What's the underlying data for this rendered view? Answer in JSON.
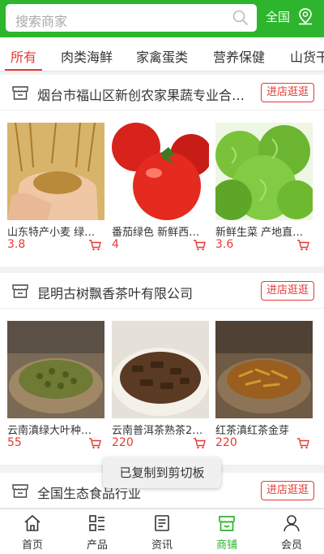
{
  "header": {
    "search_placeholder": "搜索商家",
    "region": "全国"
  },
  "tabs": [
    {
      "label": "所有",
      "active": true
    },
    {
      "label": "肉类海鲜"
    },
    {
      "label": "家禽蛋类"
    },
    {
      "label": "营养保健"
    },
    {
      "label": "山货干"
    }
  ],
  "shops": [
    {
      "name": "烟台市福山区新创农家果蔬专业合…",
      "visit_label": "进店逛逛",
      "products": [
        {
          "name": "山东特产小麦 绿…",
          "price": "3.8"
        },
        {
          "name": "番茄绿色 新鲜西…",
          "price": "4"
        },
        {
          "name": "新鲜生菜 产地直…",
          "price": "3.6"
        }
      ]
    },
    {
      "name": "昆明古树飘香茶叶有限公司",
      "visit_label": "进店逛逛",
      "products": [
        {
          "name": "云南滇绿大叶种…",
          "price": "55"
        },
        {
          "name": "云南普洱茶熟茶2…",
          "price": "220"
        },
        {
          "name": "红茶滇红茶金芽",
          "price": "220"
        }
      ]
    },
    {
      "name": "全国生态食品行业",
      "visit_label": "进店逛逛"
    }
  ],
  "toast": "已复制到剪切板",
  "bottom_nav": [
    {
      "label": "首页",
      "icon": "home-icon"
    },
    {
      "label": "产品",
      "icon": "products-icon"
    },
    {
      "label": "资讯",
      "icon": "news-icon"
    },
    {
      "label": "商铺",
      "icon": "store-icon",
      "active": true
    },
    {
      "label": "会员",
      "icon": "user-icon"
    }
  ],
  "colors": {
    "brand_green": "#2db52d",
    "accent_red": "#e53935"
  }
}
